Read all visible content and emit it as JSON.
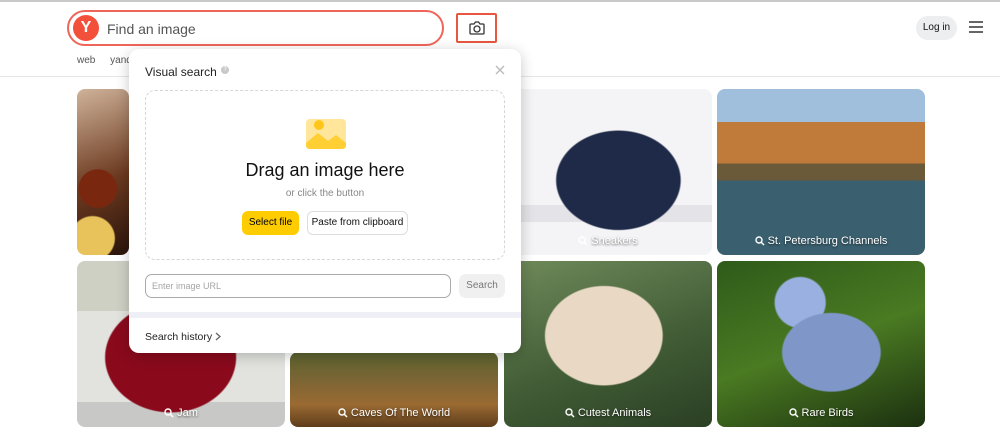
{
  "header": {
    "search_placeholder": "Find an image",
    "logo_letter": "Y",
    "login_label": "Log in",
    "nav_tabs": [
      "web",
      "yand"
    ]
  },
  "popup": {
    "title": "Visual search",
    "drop_title": "Drag an image here",
    "drop_subtitle": "or click the button",
    "select_file_label": "Select file",
    "paste_label": "Paste from clipboard",
    "url_placeholder": "Enter image URL",
    "search_label": "Search",
    "history_label": "Search history"
  },
  "tiles": [
    {
      "caption": ""
    },
    {
      "caption": "Sneakers"
    },
    {
      "caption": "St. Petersburg Channels"
    },
    {
      "caption": "Jam"
    },
    {
      "caption": "Caves Of The World"
    },
    {
      "caption": "Cutest Animals"
    },
    {
      "caption": "Rare Birds"
    }
  ],
  "colors": {
    "accent_red": "#f0655a",
    "select_button": "#ffcc00"
  },
  "icons": {
    "camera": "camera-search-icon",
    "menu": "hamburger-menu-icon",
    "close": "close-icon",
    "help": "help-icon",
    "image": "image-icon",
    "chevron": "chevron-right-icon",
    "search": "search-icon"
  }
}
